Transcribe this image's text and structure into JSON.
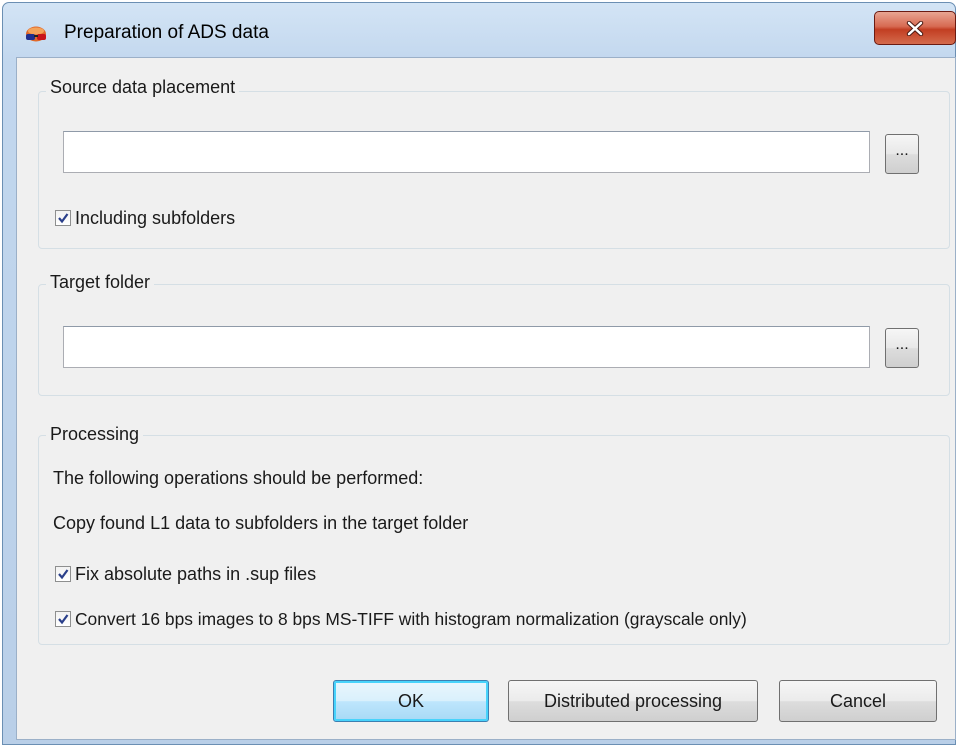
{
  "window": {
    "title": "Preparation of ADS data",
    "app_icon": "stereo-glasses-icon",
    "close_icon": "close-icon"
  },
  "source": {
    "group_title": "Source data placement",
    "path_value": "",
    "browse_label": "...",
    "include_subfolders_label": "Including subfolders",
    "include_subfolders_checked": true
  },
  "target": {
    "group_title": "Target folder",
    "path_value": "",
    "browse_label": "..."
  },
  "processing": {
    "group_title": "Processing",
    "intro_text": "The following operations should be performed:",
    "copy_text": "Copy found L1 data to subfolders in the target folder",
    "fix_paths_label": "Fix absolute paths in .sup files",
    "fix_paths_checked": true,
    "convert_label": "Convert 16 bps images to 8 bps MS-TIFF with histogram normalization (grayscale only)",
    "convert_checked": true
  },
  "buttons": {
    "ok_label": "OK",
    "distributed_label": "Distributed processing",
    "cancel_label": "Cancel"
  },
  "colors": {
    "close_button": "#c23e22",
    "default_button_border": "#3c7fb1",
    "frame": "#c2d7ee"
  }
}
